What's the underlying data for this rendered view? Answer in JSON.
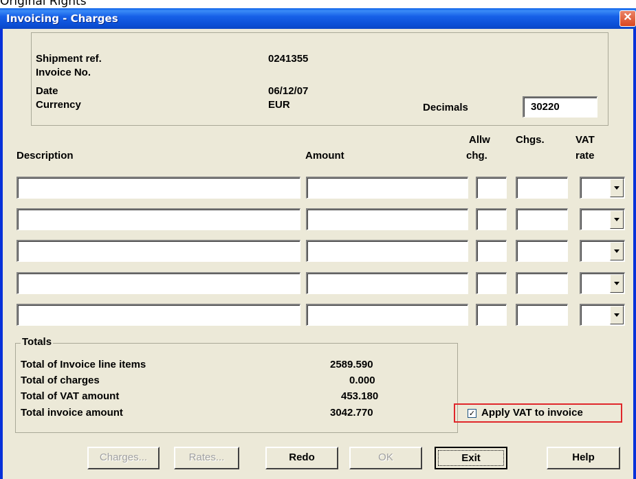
{
  "background_label": "Original Rights",
  "window": {
    "title": "Invoicing - Charges",
    "close_icon": "close-icon"
  },
  "info": {
    "shipment_ref_label": "Shipment ref.",
    "shipment_ref_value": "0241355",
    "invoice_no_label": "Invoice No.",
    "date_label": "Date",
    "date_value": "06/12/07",
    "currency_label": "Currency",
    "currency_value": "EUR",
    "decimals_label": "Decimals",
    "decimals_value": "30220"
  },
  "columns": {
    "description": "Description",
    "amount": "Amount",
    "allw_1": "Allw",
    "allw_2": "chg.",
    "chgs": "Chgs.",
    "vat_1": "VAT",
    "vat_2": "rate"
  },
  "rows": [
    {
      "description": "",
      "amount": "",
      "allw": "",
      "chgs": "",
      "vat": ""
    },
    {
      "description": "",
      "amount": "",
      "allw": "",
      "chgs": "",
      "vat": ""
    },
    {
      "description": "",
      "amount": "",
      "allw": "",
      "chgs": "",
      "vat": ""
    },
    {
      "description": "",
      "amount": "",
      "allw": "",
      "chgs": "",
      "vat": ""
    },
    {
      "description": "",
      "amount": "",
      "allw": "",
      "chgs": "",
      "vat": ""
    }
  ],
  "totals": {
    "legend": "Totals",
    "line_items_label": "Total of Invoice line items",
    "line_items_value": "2589.590",
    "charges_label": "Total of charges",
    "charges_value": "0.000",
    "vat_label": "Total of VAT amount",
    "vat_value": "453.180",
    "invoice_label": "Total invoice amount",
    "invoice_value": "3042.770"
  },
  "apply_vat": {
    "label": "Apply VAT to invoice",
    "checked": true
  },
  "buttons": {
    "charges": "Charges...",
    "rates": "Rates...",
    "redo": "Redo",
    "ok": "OK",
    "exit": "Exit",
    "help": "Help"
  }
}
